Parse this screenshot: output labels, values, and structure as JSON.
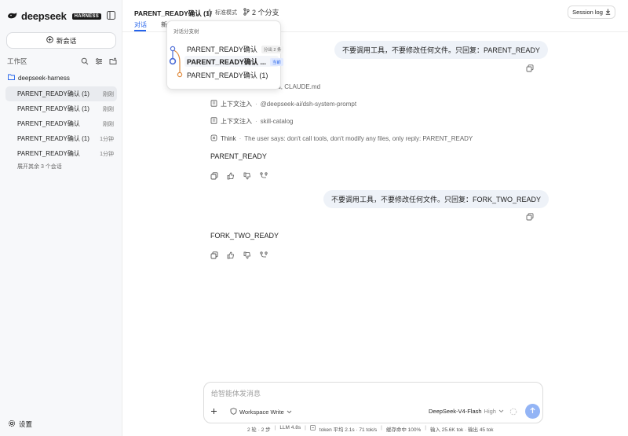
{
  "sidebar": {
    "logo_text": "deepseek",
    "logo_badge": "HARNESS",
    "new_chat_label": "新会话",
    "workspace_title": "工作区",
    "project_name": "deepseek-harness",
    "sessions": [
      {
        "name": "PARENT_READY确认 (1)",
        "time": "刚刚",
        "active": true
      },
      {
        "name": "PARENT_READY确认 (1)",
        "time": "刚刚",
        "active": false
      },
      {
        "name": "PARENT_READY确认",
        "time": "刚刚",
        "active": false
      },
      {
        "name": "PARENT_READY确认 (1)",
        "time": "1分钟",
        "active": false
      },
      {
        "name": "PARENT_READY确认",
        "time": "1分钟",
        "active": false
      }
    ],
    "expand_more": "展开其余 3 个会话",
    "settings_label": "设置"
  },
  "header": {
    "title": "PARENT_READY确认 (1)",
    "mode": "标准模式",
    "branches": "2 个分支",
    "session_log": "Session log",
    "tabs": [
      "对话",
      "新"
    ]
  },
  "branch_popup": {
    "title": "对话分支树",
    "items": [
      {
        "label": "PARENT_READY确认",
        "tag": "分出 2 条"
      },
      {
        "label": "PARENT_READY确认 ...",
        "tag": "当前"
      },
      {
        "label": "PARENT_READY确认 (1)",
        "tag": ""
      }
    ]
  },
  "conversation": {
    "msg1": "不要调用工具，不要修改任何文件。只回复：PARENT_READY",
    "ctx_rows": [
      {
        "label": "",
        "value": "...md, CLAUDE.md"
      },
      {
        "label": "上下文注入",
        "value": "@deepseek-ai/dsh-system-prompt"
      },
      {
        "label": "上下文注入",
        "value": "skill-catalog"
      },
      {
        "label": "Think",
        "value": "The user says: don't call tools, don't modify any files, only reply: PARENT_READY"
      }
    ],
    "answer1": "PARENT_READY",
    "msg2": "不要调用工具，不要修改任何文件。只回复：FORK_TWO_READY",
    "answer2": "FORK_TWO_READY"
  },
  "composer": {
    "placeholder": "给智能体发消息",
    "workspace": "Workspace Write",
    "model": "DeepSeek-V4-Flash",
    "level": "High"
  },
  "status_bar": {
    "turns": "2 轮 · 2 步",
    "llm": "LLM 4.8s",
    "tokens": "token 平均 2.1s · 71 tok/s",
    "cache": "缓存命中 100%",
    "io": "输入 25.6K tok · 输出 45 tok"
  },
  "colors": {
    "accent": "#2563eb",
    "bubble": "#eef2f8",
    "branch_blue": "#4b6bd6",
    "branch_orange": "#e08a3c"
  }
}
